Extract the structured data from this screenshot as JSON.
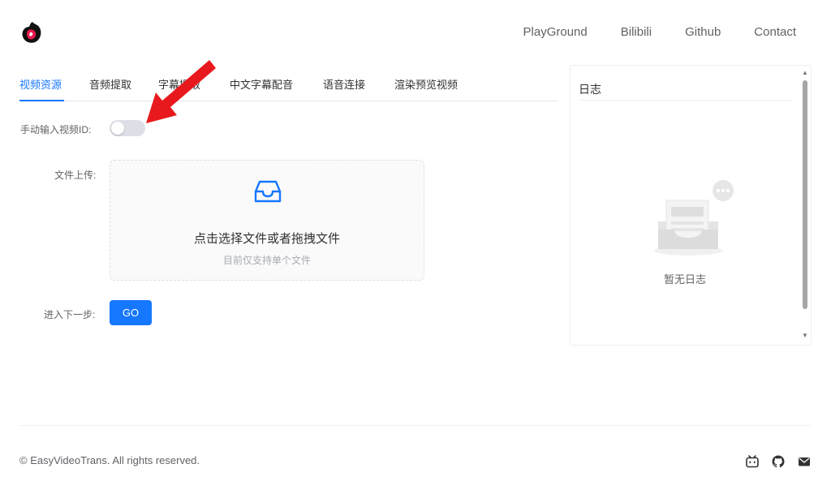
{
  "nav": {
    "logo": "app-logo",
    "links": [
      "PlayGround",
      "Bilibili",
      "Github",
      "Contact"
    ]
  },
  "tabs": [
    "视频资源",
    "音频提取",
    "字幕提取",
    "中文字幕配音",
    "语音连接",
    "渲染预览视频"
  ],
  "active_tab": 0,
  "form": {
    "manual_id_label": "手动输入视频ID:",
    "manual_id_switch": "off",
    "upload_label": "文件上传:",
    "upload_text": "点击选择文件或者拖拽文件",
    "upload_hint": "目前仅支持单个文件",
    "next_label": "进入下一步:",
    "go_label": "GO"
  },
  "log": {
    "title": "日志",
    "empty_text": "暂无日志"
  },
  "footer": {
    "copyright": "© EasyVideoTrans. All rights reserved.",
    "icons": [
      "bilibili-icon",
      "github-icon",
      "mail-icon"
    ]
  },
  "colors": {
    "accent": "#1677ff",
    "annotation_arrow": "#e8191c"
  }
}
